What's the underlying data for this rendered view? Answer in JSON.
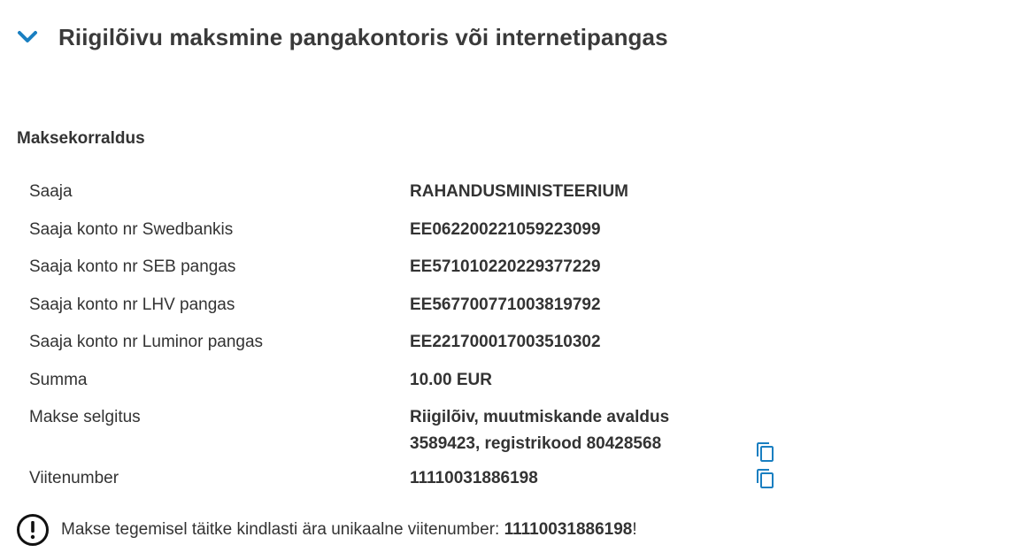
{
  "section": {
    "title": "Riigilõivu maksmine pangakontoris või internetipangas",
    "icon": "chevron-down-icon"
  },
  "payment_order": {
    "heading": "Maksekorraldus",
    "rows": [
      {
        "label": "Saaja",
        "value": "RAHANDUSMINISTEERIUM"
      },
      {
        "label": "Saaja konto nr Swedbankis",
        "value": "EE062200221059223099"
      },
      {
        "label": "Saaja konto nr SEB pangas",
        "value": "EE571010220229377229"
      },
      {
        "label": "Saaja konto nr LHV pangas",
        "value": "EE567700771003819792"
      },
      {
        "label": "Saaja konto nr Luminor pangas",
        "value": "EE221700017003510302"
      },
      {
        "label": "Summa",
        "value": "10.00 EUR"
      },
      {
        "label": "Makse selgitus",
        "value_line1": "Riigilõiv, muutmiskande avaldus",
        "value_line2": "3589423, registrikood 80428568",
        "copy_icon": "copy-icon"
      },
      {
        "label": "Viitenumber",
        "value": "11110031886198",
        "copy_icon": "copy-icon"
      }
    ]
  },
  "notice": {
    "icon": "exclamation-circle-icon",
    "text_before": "Makse tegemisel täitke kindlasti ära unikaalne viitenumber: ",
    "reference": "11110031886198",
    "text_after": "!"
  },
  "colors": {
    "accent": "#1a7fc1",
    "text": "#333333"
  }
}
